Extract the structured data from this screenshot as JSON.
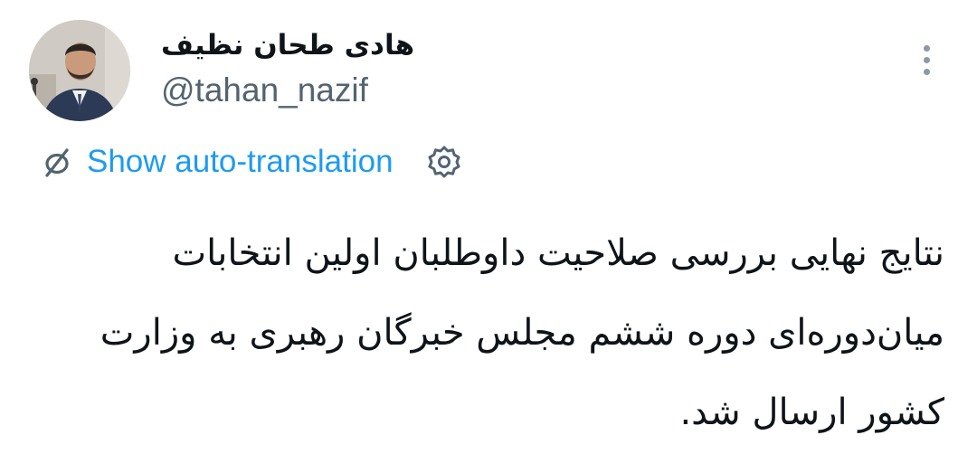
{
  "author": {
    "display_name": "هادی طحان نظیف",
    "handle": "@tahan_nazif"
  },
  "translation": {
    "link_label": "Show auto-translation",
    "icon": "translate-off-icon",
    "settings_icon": "gear-icon"
  },
  "more_icon": "more-vertical-icon",
  "tweet": {
    "lines": [
      "نتایج نهایی بررسی صلاحیت داوطلبان اولین انتخابات",
      "میان‌دوره‌ای دوره ششم مجلس خبرگان رهبری به وزارت",
      "کشور ارسال شد."
    ]
  },
  "colors": {
    "link": "#1d9bf0",
    "secondary_text": "#536471",
    "primary_text": "#0f1419",
    "icon_gray": "#8b98a5"
  }
}
